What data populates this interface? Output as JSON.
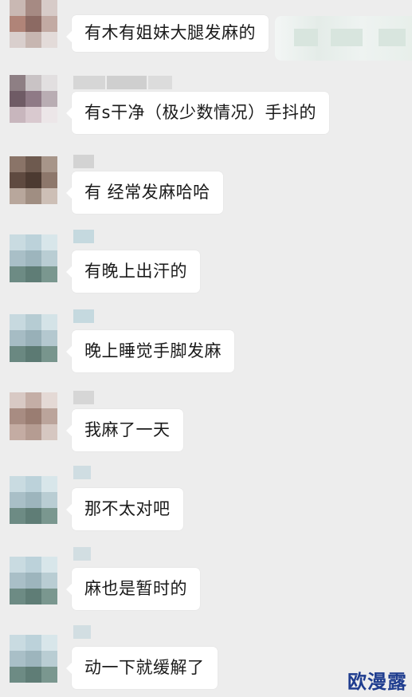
{
  "chat": {
    "messages": [
      {
        "text": "有木有姐妹大腿发麻的"
      },
      {
        "text": "有s干净（极少数情况）手抖的"
      },
      {
        "text": "有 经常发麻哈哈"
      },
      {
        "text": "有晚上出汗的"
      },
      {
        "text": "晚上睡觉手脚发麻"
      },
      {
        "text": "我麻了一天"
      },
      {
        "text": "那不太对吧"
      },
      {
        "text": "麻也是暂时的"
      },
      {
        "text": "动一下就缓解了"
      }
    ]
  },
  "watermark": {
    "text": "欧漫露"
  },
  "colors": {
    "background": "#ededed",
    "bubble": "#ffffff",
    "watermark": "#1f3d8f"
  }
}
